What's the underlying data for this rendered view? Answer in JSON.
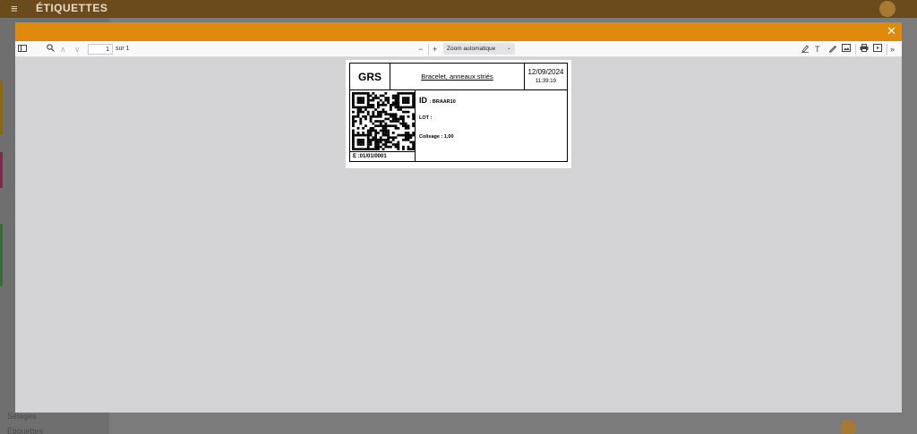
{
  "app": {
    "title": "ÉTIQUETTES",
    "sidebar_items": [
      "Sélages",
      "Étiquettes"
    ]
  },
  "modal": {
    "close_icon": "close-icon"
  },
  "pdf_toolbar": {
    "page_number": "1",
    "page_of": "sur 1",
    "zoom_label": "Zoom automatique",
    "zoom_in": "+",
    "zoom_out": "−"
  },
  "label": {
    "brand": "GRS",
    "title": "Bracelet, anneaux striés",
    "date": "12/09/2024",
    "time": "11:39:19",
    "id_label": "ID",
    "id_value": ": BRAAR10",
    "lot": "LOT :",
    "colisage": "Colisage : 1,00",
    "code": "E :01/01/0001"
  },
  "colors": {
    "header": "#e08a0b",
    "viewer_bg": "#d4d4d7"
  }
}
